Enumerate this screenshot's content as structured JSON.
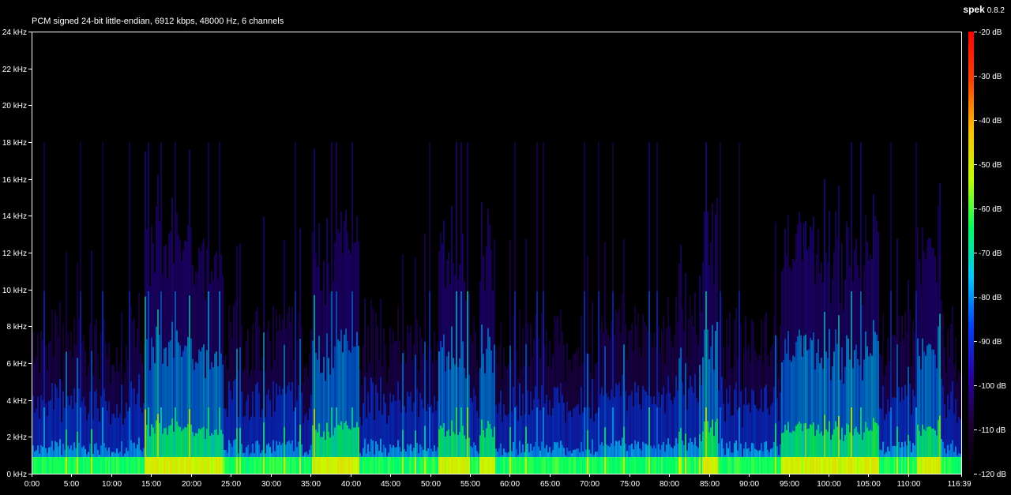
{
  "app": {
    "name": "spek",
    "version": "0.8.2"
  },
  "file_info": "PCM signed 24-bit little-endian, 6912 kbps, 48000 Hz, 6 channels",
  "chart_data": {
    "type": "heatmap",
    "title": "",
    "x_axis": {
      "unit": "minutes",
      "range": [
        0,
        116.65
      ],
      "tick_labels": [
        "0:00",
        "5:00",
        "10:00",
        "15:00",
        "20:00",
        "25:00",
        "30:00",
        "35:00",
        "40:00",
        "45:00",
        "50:00",
        "55:00",
        "60:00",
        "65:00",
        "70:00",
        "75:00",
        "80:00",
        "85:00",
        "90:00",
        "95:00",
        "100:00",
        "105:00",
        "110:00",
        "116:39"
      ],
      "tick_values": [
        0,
        5,
        10,
        15,
        20,
        25,
        30,
        35,
        40,
        45,
        50,
        55,
        60,
        65,
        70,
        75,
        80,
        85,
        90,
        95,
        100,
        105,
        110,
        116.65
      ]
    },
    "y_axis": {
      "unit": "kHz",
      "range": [
        0,
        24
      ],
      "tick_labels": [
        "0 kHz",
        "2 kHz",
        "4 kHz",
        "6 kHz",
        "8 kHz",
        "10 kHz",
        "12 kHz",
        "14 kHz",
        "16 kHz",
        "18 kHz",
        "20 kHz",
        "22 kHz",
        "24 kHz"
      ],
      "tick_values": [
        0,
        2,
        4,
        6,
        8,
        10,
        12,
        14,
        16,
        18,
        20,
        22,
        24
      ]
    },
    "color_scale": {
      "unit": "dB",
      "range": [
        -120,
        -20
      ],
      "tick_labels": [
        "-20 dB",
        "-30 dB",
        "-40 dB",
        "-50 dB",
        "-60 dB",
        "-70 dB",
        "-80 dB",
        "-90 dB",
        "-100 dB",
        "-110 dB",
        "-120 dB"
      ],
      "tick_values": [
        -20,
        -30,
        -40,
        -50,
        -60,
        -70,
        -80,
        -90,
        -100,
        -110,
        -120
      ],
      "colors": [
        "#000000",
        "#1e0030",
        "#2a00a8",
        "#0040ff",
        "#00c8ff",
        "#00ff60",
        "#c0ff00",
        "#ffc000",
        "#ff4000",
        "#ff0000"
      ]
    },
    "approx_content_cutoff_khz": 18,
    "notable_bright_segments_minutes": [
      [
        14,
        22
      ],
      [
        22,
        24
      ],
      [
        35,
        41
      ],
      [
        51,
        55
      ],
      [
        56,
        58
      ],
      [
        84,
        86
      ],
      [
        94,
        106
      ],
      [
        111,
        114
      ]
    ]
  }
}
